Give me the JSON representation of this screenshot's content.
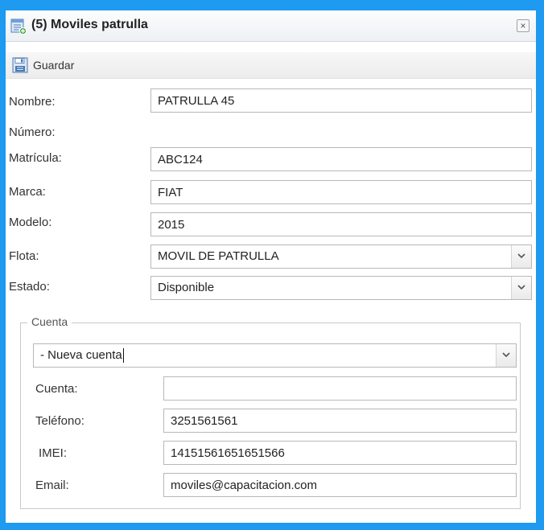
{
  "window": {
    "title": "(5) Moviles patrulla",
    "close_symbol": "×"
  },
  "toolbar": {
    "save_label": "Guardar",
    "save_icon": "save-icon"
  },
  "form": {
    "nombre": {
      "label": "Nombre:",
      "value": "PATRULLA 45"
    },
    "numero": {
      "label": "Número:"
    },
    "matricula": {
      "label": "Matrícula:",
      "value": "ABC124"
    },
    "marca": {
      "label": "Marca:",
      "value": "FIAT"
    },
    "modelo": {
      "label": "Modelo:",
      "value": "2015"
    },
    "flota": {
      "label": "Flota:",
      "value": "MOVIL DE PATRULLA"
    },
    "estado": {
      "label": "Estado:",
      "value": "Disponible"
    }
  },
  "cuenta_section": {
    "legend": "Cuenta",
    "selector_value": "- Nueva cuenta",
    "cuenta": {
      "label": "Cuenta:",
      "value": ""
    },
    "telefono": {
      "label": "Teléfono:",
      "value": "3251561561"
    },
    "imei": {
      "label": "IMEI:",
      "value": "14151561651651566"
    },
    "email": {
      "label": "Email:",
      "value": "moviles@capacitacion.com"
    }
  },
  "colors": {
    "window_border": "#1e9af0",
    "titlebar_bg": "#edf0f4",
    "input_border": "#b8b8b8"
  }
}
